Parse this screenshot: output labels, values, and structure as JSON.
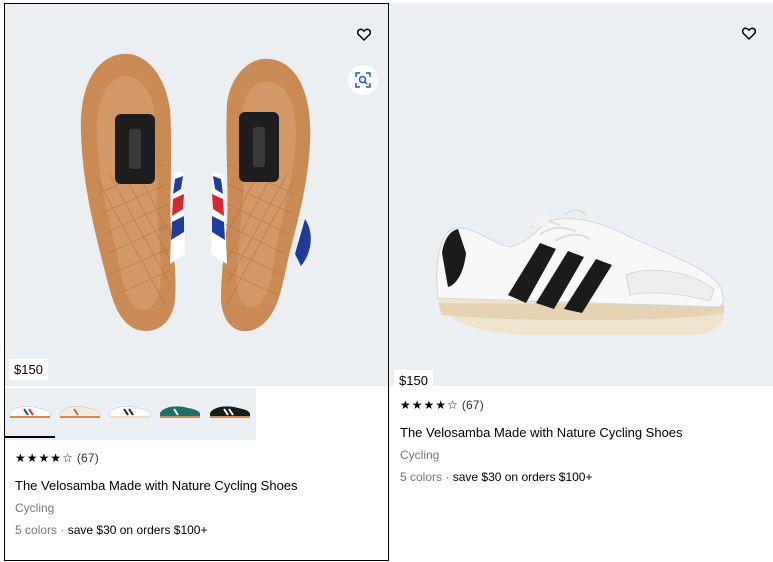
{
  "products": [
    {
      "price": "$150",
      "rating_stars": 4.5,
      "rating_count": "(67)",
      "title": "The Velosamba Made with Nature Cycling Shoes",
      "category": "Cycling",
      "colors": "5 colors",
      "separator": "·",
      "promo": "save $30 on orders $100+",
      "wishlist_icon": "heart-outline-icon",
      "visual_search_icon": "visual-search-icon",
      "thumbnails": [
        "white-blue-red",
        "cream-tan",
        "white-black-green",
        "teal-white",
        "black-white"
      ]
    },
    {
      "price": "$150",
      "rating_stars": 4.5,
      "rating_count": "(67)",
      "title": "The Velosamba Made with Nature Cycling Shoes",
      "category": "Cycling",
      "colors": "5 colors",
      "separator": "·",
      "promo": "save $30 on orders $100+",
      "wishlist_icon": "heart-outline-icon"
    }
  ],
  "colors": {
    "image_bg": "#eceff1",
    "gum_sole": "#c98a55",
    "muted_text": "#767677"
  }
}
